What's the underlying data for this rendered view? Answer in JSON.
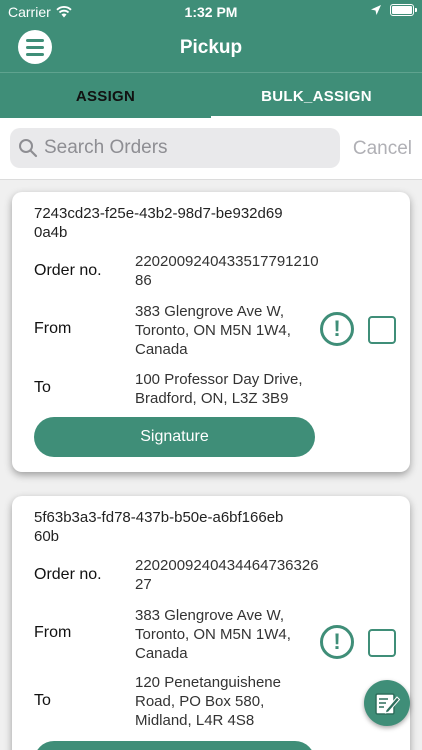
{
  "status": {
    "carrier": "Carrier",
    "time": "1:32 PM"
  },
  "nav": {
    "title": "Pickup"
  },
  "tabs": [
    {
      "label": "ASSIGN"
    },
    {
      "label": "BULK_ASSIGN"
    }
  ],
  "search": {
    "placeholder": "Search Orders",
    "cancel_label": "Cancel"
  },
  "labels": {
    "order_no": "Order no.",
    "from": "From",
    "to": "To",
    "signature": "Signature",
    "alert": "!"
  },
  "orders": [
    {
      "id": "7243cd23-f25e-43b2-98d7-be932d690a4b",
      "order_no": "220200924043351779121086",
      "from": "383 Glengrove Ave W, Toronto, ON M5N 1W4, Canada",
      "to": "100 Professor Day Drive, Bradford, ON, L3Z 3B9"
    },
    {
      "id": "5f63b3a3-fd78-437b-b50e-a6bf166eb60b",
      "order_no": "220200924043446473632627",
      "from": "383 Glengrove Ave W, Toronto, ON M5N 1W4, Canada",
      "to": "120 Penetanguishene Road, PO Box 580, Midland, L4R 4S8"
    }
  ],
  "colors": {
    "primary": "#3f8e78",
    "background": "#f0f0f0"
  }
}
